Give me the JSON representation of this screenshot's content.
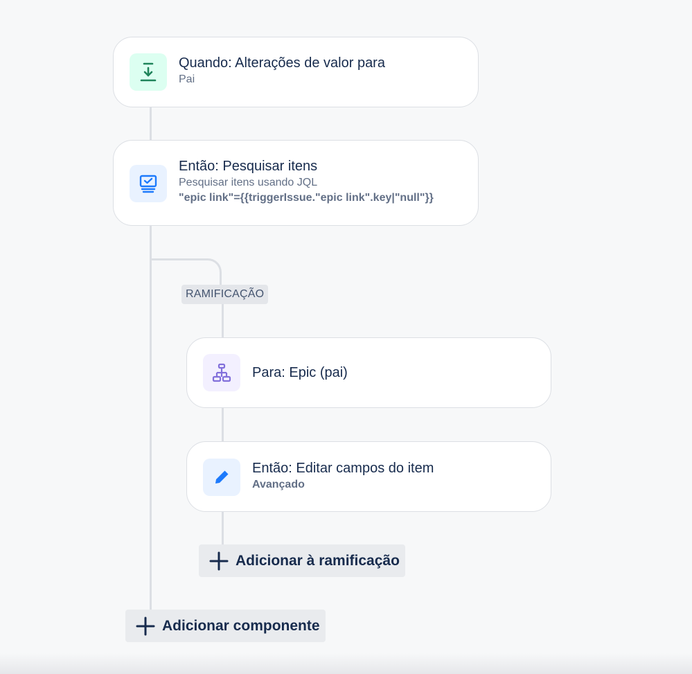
{
  "colors": {
    "background": "#f7f8f9",
    "card_border": "#dcdfe4",
    "connector": "#dcdfe4",
    "trigger_icon_bg": "#dcfff1",
    "trigger_icon": "#1f845a",
    "action_icon_bg": "#e9f2ff",
    "action_icon": "#1d7afc",
    "branch_icon_bg": "#f3f0ff",
    "branch_icon": "#8270db"
  },
  "rule": {
    "trigger": {
      "title": "Quando: Alterações de valor para",
      "subtitle": "Pai",
      "icon": "download-to-line-icon"
    },
    "lookup_action": {
      "title": "Então: Pesquisar itens",
      "subtitle": "Pesquisar itens usando JQL",
      "code": "\"epic link\"={{triggerIssue.\"epic link\".key|\"null\"}}",
      "icon": "screen-check-icon"
    },
    "branch": {
      "badge": "RAMIFICAÇÃO",
      "condition": {
        "title": "Para: Epic (pai)",
        "icon": "hierarchy-icon"
      },
      "edit_action": {
        "title": "Então: Editar campos do item",
        "subtitle": "Avançado",
        "icon": "pencil-icon"
      },
      "add_button": "Adicionar à ramificação"
    },
    "add_component_button": "Adicionar componente"
  }
}
